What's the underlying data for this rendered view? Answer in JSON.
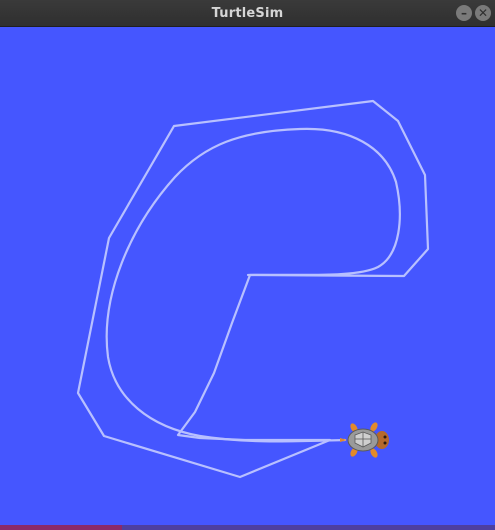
{
  "window": {
    "title": "TurtleSim",
    "minimize_glyph": "–",
    "close_glyph": "✕"
  },
  "canvas": {
    "background_color": "#4556ff",
    "pen_color": "#b8c0ff"
  },
  "turtle": {
    "icon": "turtle-icon",
    "heading": "east"
  }
}
